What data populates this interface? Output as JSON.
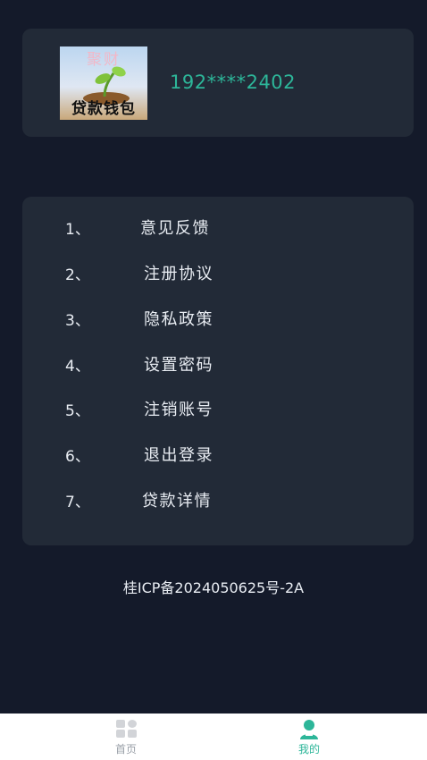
{
  "profile": {
    "avatar_top_text": "聚财",
    "avatar_bottom_text": "贷款钱包",
    "phone": "192****2402"
  },
  "menu": [
    {
      "num": "1、",
      "label": "意见反馈"
    },
    {
      "num": "2、",
      "label": "注册协议"
    },
    {
      "num": "3、",
      "label": "隐私政策"
    },
    {
      "num": "4、",
      "label": "设置密码"
    },
    {
      "num": "5、",
      "label": "注销账号"
    },
    {
      "num": "6、",
      "label": "退出登录"
    },
    {
      "num": "7、",
      "label": "贷款详情"
    }
  ],
  "icp": "桂ICP备2024050625号-2A",
  "tabbar": {
    "home": {
      "label": "首页",
      "icon": "grid-icon",
      "color": "#9aa0a8"
    },
    "mine": {
      "label": "我的",
      "icon": "user-icon",
      "color": "#2db699"
    }
  },
  "colors": {
    "background": "#141a2a",
    "card": "#222a37",
    "accent": "#2db699"
  }
}
